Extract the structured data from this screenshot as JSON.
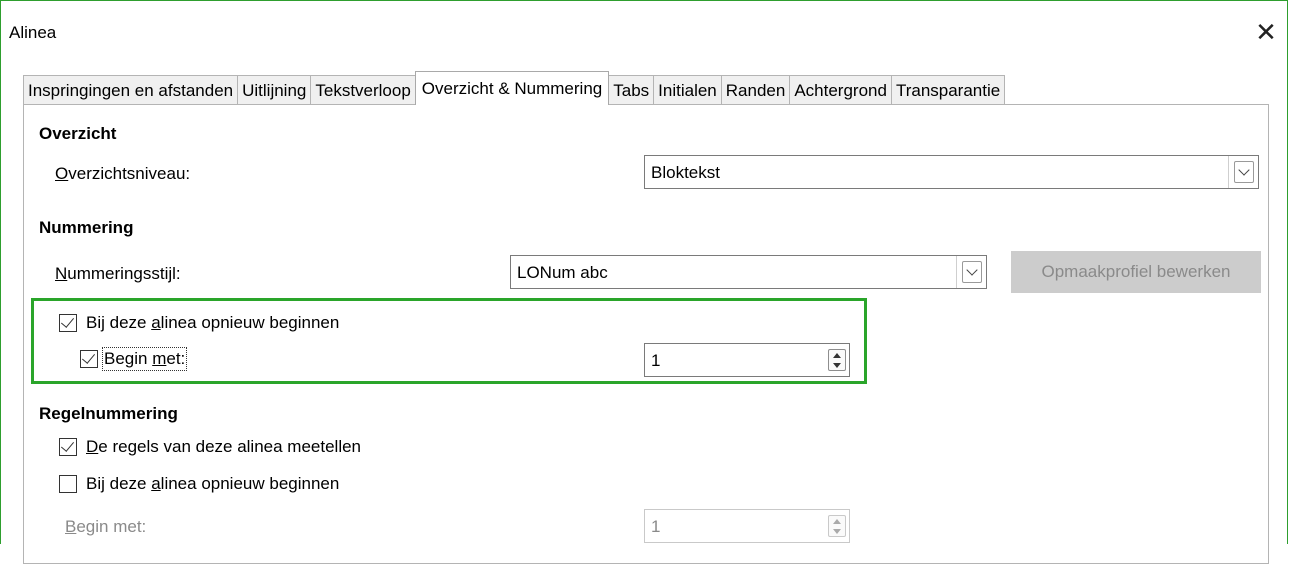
{
  "window": {
    "title": "Alinea",
    "close_glyph": "✕"
  },
  "tabs": [
    {
      "label": "Inspringingen en afstanden",
      "active": false
    },
    {
      "label": "Uitlijning",
      "active": false
    },
    {
      "label": "Tekstverloop",
      "active": false
    },
    {
      "label": "Overzicht & Nummering",
      "active": true
    },
    {
      "label": "Tabs",
      "active": false
    },
    {
      "label": "Initialen",
      "active": false
    },
    {
      "label": "Randen",
      "active": false
    },
    {
      "label": "Achtergrond",
      "active": false
    },
    {
      "label": "Transparantie",
      "active": false
    }
  ],
  "overzicht": {
    "heading": "Overzicht",
    "level_label_mnemonic": "O",
    "level_label_rest": "verzichtsniveau:",
    "level_value": "Bloktekst"
  },
  "nummering": {
    "heading": "Nummering",
    "style_label_mnemonic": "N",
    "style_label_rest": "ummeringsstijl:",
    "style_value": "LONum abc",
    "edit_button": "Opmaakprofiel bewerken",
    "restart_label_pre": "Bij deze ",
    "restart_label_mnemonic": "a",
    "restart_label_post": "linea opnieuw beginnen",
    "restart_checked": true,
    "start_label_pre": "Begin ",
    "start_label_mnemonic": "m",
    "start_label_post": "et:",
    "start_checked": true,
    "start_value": "1"
  },
  "regelnummering": {
    "heading": "Regelnummering",
    "count_label_mnemonic": "D",
    "count_label_rest": "e regels van deze alinea meetellen",
    "count_checked": true,
    "restart_label_pre": "Bij deze ",
    "restart_label_mnemonic": "a",
    "restart_label_post": "linea opnieuw beginnen",
    "restart_checked": false,
    "start_label_mnemonic": "B",
    "start_label_rest": "egin met:",
    "start_value": "1"
  },
  "colors": {
    "highlight": "#2aa52a",
    "disabled_button_bg": "#cccccc"
  }
}
